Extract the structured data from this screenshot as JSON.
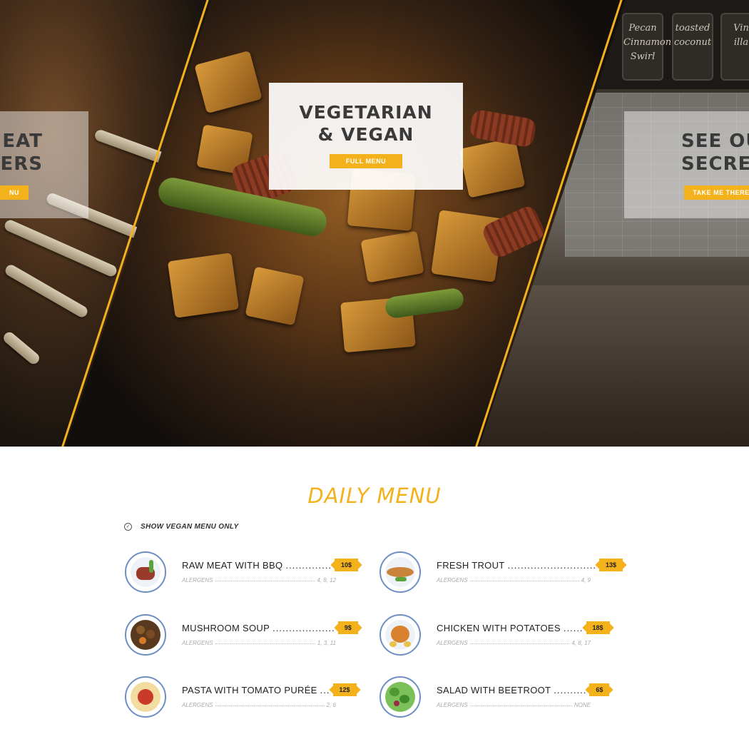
{
  "hero": {
    "left_card": {
      "title_line1": "MEAT",
      "title_line2": "ERS",
      "button": "NU"
    },
    "center_card": {
      "title_line1": "VEGETARIAN",
      "title_line2": "& VEGAN",
      "button": "FULL MENU"
    },
    "right_card": {
      "title_line1": "SEE OU",
      "title_line2": "SECRET",
      "button": "TAKE ME THERE"
    },
    "jars": [
      "Pecan",
      "Cinnamon",
      "Swirl",
      "toasted",
      "coconut",
      "Vin",
      "illa"
    ],
    "accent_color": "#f3b11c"
  },
  "menu": {
    "title": "DAILY MENU",
    "vegan_toggle": "SHOW VEGAN MENU ONLY",
    "allergen_label": "ALERGENS",
    "items": [
      {
        "name": "RAW MEAT WITH BBQ",
        "dots": "..............",
        "price": "10$",
        "allergens": "4, 8, 12",
        "icon": "steak-plate-icon"
      },
      {
        "name": "FRESH TROUT",
        "dots": "...........................",
        "price": "13$",
        "allergens": "4, 9",
        "icon": "trout-plate-icon"
      },
      {
        "name": "MUSHROOM SOUP",
        "dots": "...................",
        "price": "9$",
        "allergens": "1, 3, 11",
        "icon": "soup-plate-icon"
      },
      {
        "name": "CHICKEN WITH POTATOES",
        "dots": "......",
        "price": "18$",
        "allergens": "4, 8, 17",
        "icon": "chicken-plate-icon"
      },
      {
        "name": "PASTA WITH TOMATO PURÉE",
        "dots": "...",
        "price": "12$",
        "allergens": "2, 6",
        "icon": "pasta-plate-icon"
      },
      {
        "name": "SALAD WITH BEETROOT",
        "dots": "..........",
        "price": "6$",
        "allergens": "NONE",
        "icon": "salad-plate-icon"
      }
    ]
  }
}
